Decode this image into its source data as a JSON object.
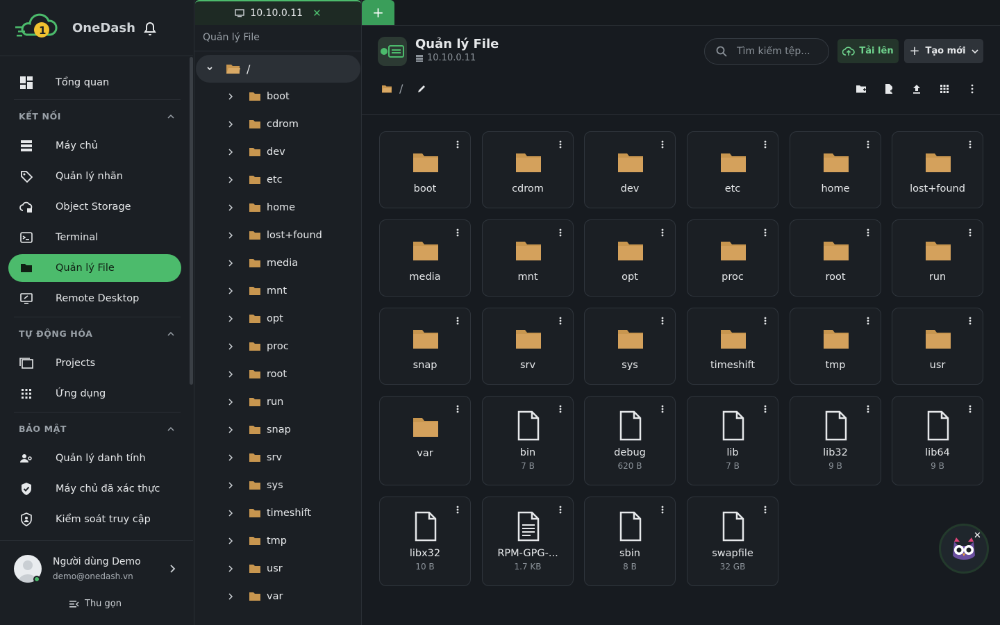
{
  "app": {
    "name": "OneDash"
  },
  "sidebar": {
    "overview": "Tổng quan",
    "sections": [
      {
        "title": "KẾT NỐI",
        "items": [
          "Máy chủ",
          "Quản lý nhãn",
          "Object Storage",
          "Terminal",
          "Quản lý File",
          "Remote Desktop"
        ]
      },
      {
        "title": "TỰ ĐỘNG HÓA",
        "items": [
          "Projects",
          "Ứng dụng"
        ]
      },
      {
        "title": "BẢO MẬT",
        "items": [
          "Quản lý danh tính",
          "Máy chủ đã xác thực",
          "Kiểm soát truy cập"
        ]
      }
    ],
    "active_item": "Quản lý File",
    "user": {
      "name": "Người dùng Demo",
      "email": "demo@onedash.vn"
    },
    "collapse_label": "Thu gọn"
  },
  "tabs": [
    {
      "label": "10.10.0.11",
      "close": "✕"
    }
  ],
  "add_tab": "+",
  "tree": {
    "title": "Quản lý File",
    "root": "/",
    "items": [
      "boot",
      "cdrom",
      "dev",
      "etc",
      "home",
      "lost+found",
      "media",
      "mnt",
      "opt",
      "proc",
      "root",
      "run",
      "snap",
      "srv",
      "sys",
      "timeshift",
      "tmp",
      "usr",
      "var"
    ]
  },
  "header": {
    "title": "Quản lý File",
    "subtitle": "10.10.0.11",
    "search_placeholder": "Tìm kiếm tệp...",
    "upload_label": "Tải lên",
    "new_label": "Tạo mới"
  },
  "path": {
    "separator": "/"
  },
  "colors": {
    "accent": "#4cbb6c",
    "folder": "#c8964f"
  },
  "files": [
    {
      "name": "boot",
      "type": "folder",
      "size": ""
    },
    {
      "name": "cdrom",
      "type": "folder",
      "size": ""
    },
    {
      "name": "dev",
      "type": "folder",
      "size": ""
    },
    {
      "name": "etc",
      "type": "folder",
      "size": ""
    },
    {
      "name": "home",
      "type": "folder",
      "size": ""
    },
    {
      "name": "lost+found",
      "type": "folder",
      "size": ""
    },
    {
      "name": "media",
      "type": "folder",
      "size": ""
    },
    {
      "name": "mnt",
      "type": "folder",
      "size": ""
    },
    {
      "name": "opt",
      "type": "folder",
      "size": ""
    },
    {
      "name": "proc",
      "type": "folder",
      "size": ""
    },
    {
      "name": "root",
      "type": "folder",
      "size": ""
    },
    {
      "name": "run",
      "type": "folder",
      "size": ""
    },
    {
      "name": "snap",
      "type": "folder",
      "size": ""
    },
    {
      "name": "srv",
      "type": "folder",
      "size": ""
    },
    {
      "name": "sys",
      "type": "folder",
      "size": ""
    },
    {
      "name": "timeshift",
      "type": "folder",
      "size": ""
    },
    {
      "name": "tmp",
      "type": "folder",
      "size": ""
    },
    {
      "name": "usr",
      "type": "folder",
      "size": ""
    },
    {
      "name": "var",
      "type": "folder",
      "size": ""
    },
    {
      "name": "bin",
      "type": "file",
      "size": "7 B"
    },
    {
      "name": "debug",
      "type": "file",
      "size": "620 B"
    },
    {
      "name": "lib",
      "type": "file",
      "size": "7 B"
    },
    {
      "name": "lib32",
      "type": "file",
      "size": "9 B"
    },
    {
      "name": "lib64",
      "type": "file",
      "size": "9 B"
    },
    {
      "name": "libx32",
      "type": "file",
      "size": "10 B"
    },
    {
      "name": "RPM-GPG-...",
      "type": "text-file",
      "size": "1.7 KB"
    },
    {
      "name": "sbin",
      "type": "file",
      "size": "8 B"
    },
    {
      "name": "swapfile",
      "type": "file",
      "size": "32 GB"
    }
  ],
  "assistant": {
    "close": "✕"
  }
}
